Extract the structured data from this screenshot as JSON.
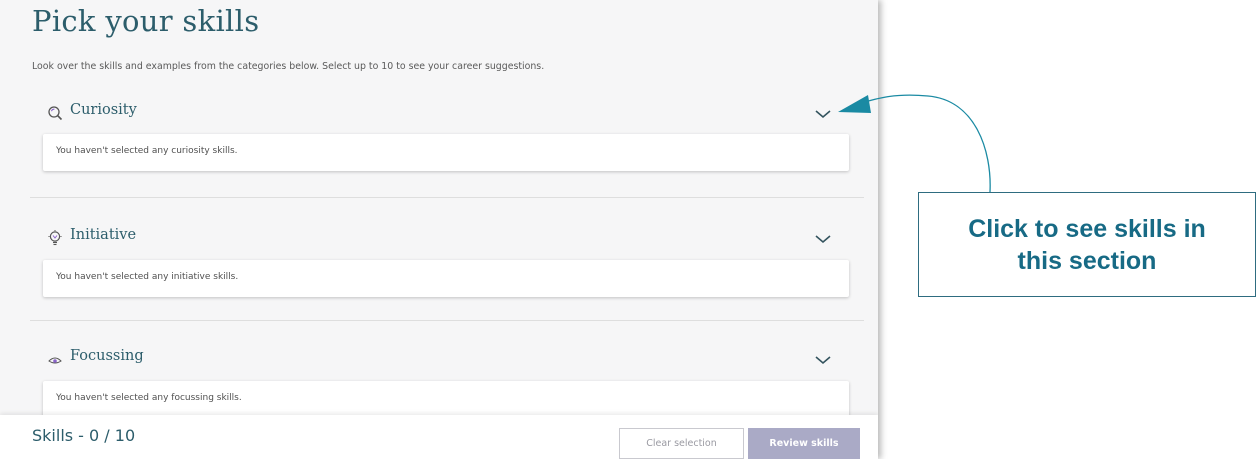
{
  "page": {
    "title": "Pick your skills",
    "intro": "Look over the skills and examples from the categories below. Select up to 10 to see your career suggestions."
  },
  "sections": [
    {
      "title": "Curiosity",
      "icon": "magnifier-icon",
      "empty_text": "You haven't selected any curiosity skills."
    },
    {
      "title": "Initiative",
      "icon": "lightbulb-icon",
      "empty_text": "You haven't selected any initiative skills."
    },
    {
      "title": "Focussing",
      "icon": "eye-icon",
      "empty_text": "You haven't selected any focussing skills."
    }
  ],
  "bottom_bar": {
    "skills_count": "Skills - 0 / 10",
    "clear_label": "Clear selection",
    "review_label": "Review skills"
  },
  "callout": {
    "line1": "Click to see skills in",
    "line2": "this section"
  },
  "colors": {
    "heading": "#2c5d6b",
    "review_button": "#aaaac6",
    "callout_border": "#2e6c80",
    "callout_text": "#176a85",
    "arrow": "#1a8aa3"
  }
}
